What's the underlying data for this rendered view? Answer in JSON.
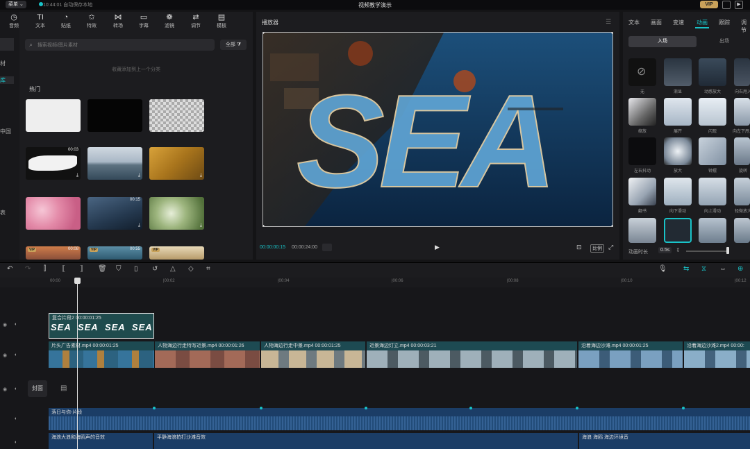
{
  "titlebar": {
    "menu": "菜单 ⌄",
    "save_status": "10:44:01 自动保存本地",
    "title": "视频教学演示",
    "vip": "VIP"
  },
  "tool_tabs": [
    {
      "label": "音频",
      "icon": "◷"
    },
    {
      "label": "文本",
      "icon": "TI"
    },
    {
      "label": "贴纸",
      "icon": "◔"
    },
    {
      "label": "特效",
      "icon": "✩"
    },
    {
      "label": "转场",
      "icon": "⋈"
    },
    {
      "label": "字幕",
      "icon": "▭"
    },
    {
      "label": "滤镜",
      "icon": "❁"
    },
    {
      "label": "调节",
      "icon": "⇄"
    },
    {
      "label": "模板",
      "icon": "▤"
    }
  ],
  "side_items": [
    "材",
    "库",
    "中国",
    "表"
  ],
  "search": {
    "placeholder": "搜索视频/图片素材",
    "filter": "全部"
  },
  "notice": "收藏添加到上一个分类",
  "section_hot": "热门",
  "thumbs": [
    {
      "dur": "",
      "bg": "#eeeeee"
    },
    {
      "dur": "",
      "bg": "#050505"
    },
    {
      "dur": "",
      "bg": "checker"
    },
    {
      "dur": "00:03",
      "bg": "brush"
    },
    {
      "dur": "",
      "bg": "mountain"
    },
    {
      "dur": "",
      "bg": "autumn"
    },
    {
      "dur": "",
      "bg": "blossom"
    },
    {
      "dur": "00:15",
      "bg": "city"
    },
    {
      "dur": "",
      "bg": "bokeh"
    },
    {
      "dur": "00:08",
      "bg": "sunset"
    },
    {
      "dur": "00:55",
      "bg": "sea"
    },
    {
      "dur": "",
      "bg": "sand"
    }
  ],
  "player": {
    "title": "播放器",
    "current_time": "00:00:00:15",
    "total_time": "00:00:24:00",
    "ratio": "比例",
    "overlay_text": "SEA"
  },
  "right_tabs": [
    "文本",
    "画面",
    "变速",
    "动画",
    "跟踪",
    "调节"
  ],
  "active_right_tab": "动画",
  "anim_subtabs": {
    "in": "入场",
    "out": "出场"
  },
  "animations": [
    {
      "label": "无"
    },
    {
      "label": "渐显"
    },
    {
      "label": "动感放大"
    },
    {
      "label": "向右甩入"
    },
    {
      "label": "缩放"
    },
    {
      "label": "展开"
    },
    {
      "label": "闪现"
    },
    {
      "label": "向左下甩入"
    },
    {
      "label": "左右抖动"
    },
    {
      "label": "放大"
    },
    {
      "label": "钟摆"
    },
    {
      "label": "旋转"
    },
    {
      "label": "翻书"
    },
    {
      "label": "向下滑动"
    },
    {
      "label": "向上滑动"
    },
    {
      "label": "轻微放大"
    },
    {
      "label": ""
    },
    {
      "label": ""
    },
    {
      "label": ""
    },
    {
      "label": ""
    }
  ],
  "anim_duration": {
    "label": "动画时长",
    "value": "0.5s"
  },
  "ruler": [
    "00:00",
    "|00:02",
    "|00:04",
    "|00:06",
    "|00:08",
    "|00:10",
    "|00:12"
  ],
  "tracks": {
    "text_clip": {
      "label": "复合片段2  00:00:01:25",
      "word": "SEA"
    },
    "cover": "封面",
    "video_clips": [
      {
        "label": "片头广告素材.mp4  00:00:01:25"
      },
      {
        "label": "人物海边行走特写近景.mp4  00:00:01:26"
      },
      {
        "label": "人物海边行走中景.mp4  00:00:01:25"
      },
      {
        "label": "近景海边灯立.mp4  00:00:03:21"
      },
      {
        "label": "沿着海边沙滩.mp4  00:00:01:25"
      },
      {
        "label": "沿着海边沙滩2.mp4  00:00:"
      }
    ],
    "music": "落日与你-片段",
    "sfx": [
      {
        "label": "海浪大浪和海鸥声的音效"
      },
      {
        "label": "平静海浪拍打沙滩音效"
      },
      {
        "label": "海浪 海鸥 海边环境音"
      }
    ]
  }
}
